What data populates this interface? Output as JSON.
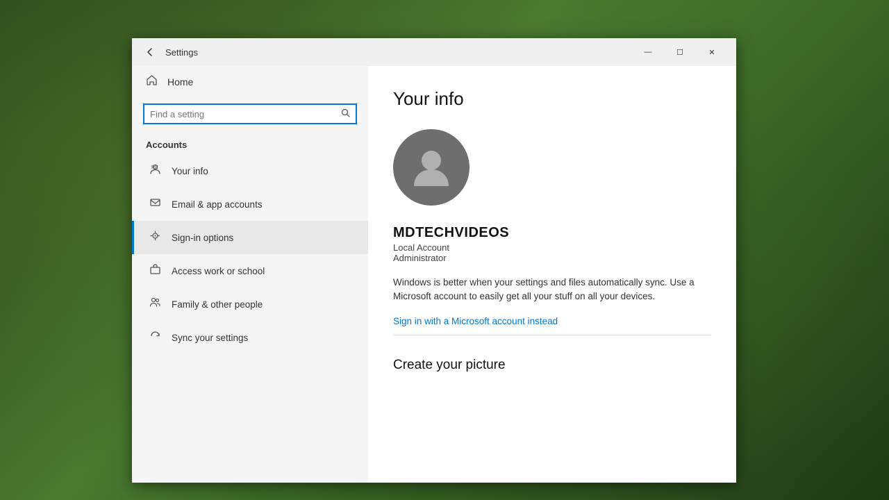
{
  "window": {
    "title": "Settings",
    "controls": {
      "minimize": "—",
      "maximize": "☐",
      "close": "✕"
    }
  },
  "sidebar": {
    "home_label": "Home",
    "search_placeholder": "Find a setting",
    "section_label": "Accounts",
    "nav_items": [
      {
        "id": "your-info",
        "label": "Your info",
        "icon": "person"
      },
      {
        "id": "email-app",
        "label": "Email & app accounts",
        "icon": "email"
      },
      {
        "id": "sign-in",
        "label": "Sign-in options",
        "icon": "key",
        "active": true
      },
      {
        "id": "access-work",
        "label": "Access work or school",
        "icon": "briefcase"
      },
      {
        "id": "family",
        "label": "Family & other people",
        "icon": "people"
      },
      {
        "id": "sync",
        "label": "Sync your settings",
        "icon": "sync"
      }
    ]
  },
  "main": {
    "page_title": "Your info",
    "username": "MDTECHVIDEOS",
    "account_type": "Local Account",
    "role": "Administrator",
    "sync_description": "Windows is better when your settings and files automatically sync. Use a Microsoft account to easily get all your stuff on all your devices.",
    "microsoft_link": "Sign in with a Microsoft account instead",
    "create_picture_title": "Create your picture"
  }
}
